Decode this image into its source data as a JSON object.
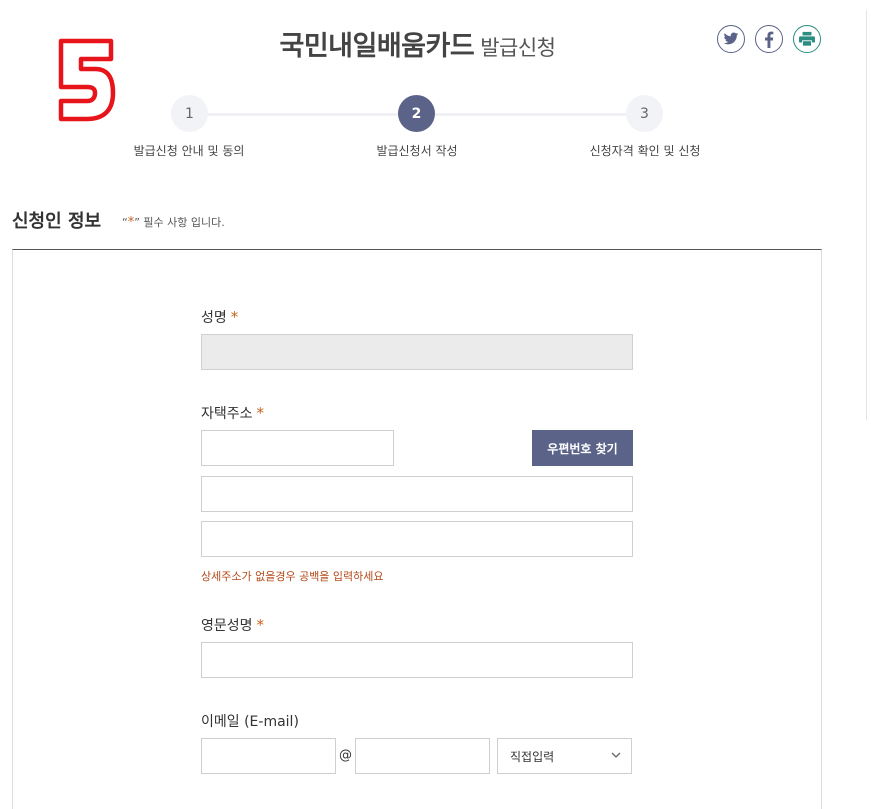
{
  "marker": "5",
  "header": {
    "title_main": "국민내일배움카드",
    "title_sub": "발급신청"
  },
  "share_icons": [
    "twitter-icon",
    "facebook-icon",
    "print-icon"
  ],
  "steps": [
    {
      "num": "1",
      "label": "발급신청 안내 및 동의"
    },
    {
      "num": "2",
      "label": "발급신청서 작성"
    },
    {
      "num": "3",
      "label": "신청자격 확인 및 신청"
    }
  ],
  "active_step": 2,
  "section": {
    "title": "신청인 정보",
    "required_note_prefix": "“",
    "required_star": "*",
    "required_note_suffix": "” 필수 사항 입니다."
  },
  "form": {
    "name_label": "성명",
    "name_value": "",
    "address_label": "자택주소",
    "zip_value": "",
    "zip_button": "우편번호 찾기",
    "address1_value": "",
    "address2_value": "",
    "address_hint": "상세주소가 없을경우 공백을 입력하세요",
    "eng_name_label": "영문성명",
    "eng_name_value": "",
    "email_label": "이메일 (E-mail)",
    "email_id_value": "",
    "email_at": "@",
    "email_domain_value": "",
    "email_domain_select": "직접입력",
    "required_mark": "*"
  },
  "colors": {
    "accent": "#5b6389",
    "required": "#c7631f",
    "hint": "#b34a1a",
    "marker": "#e8141b"
  }
}
